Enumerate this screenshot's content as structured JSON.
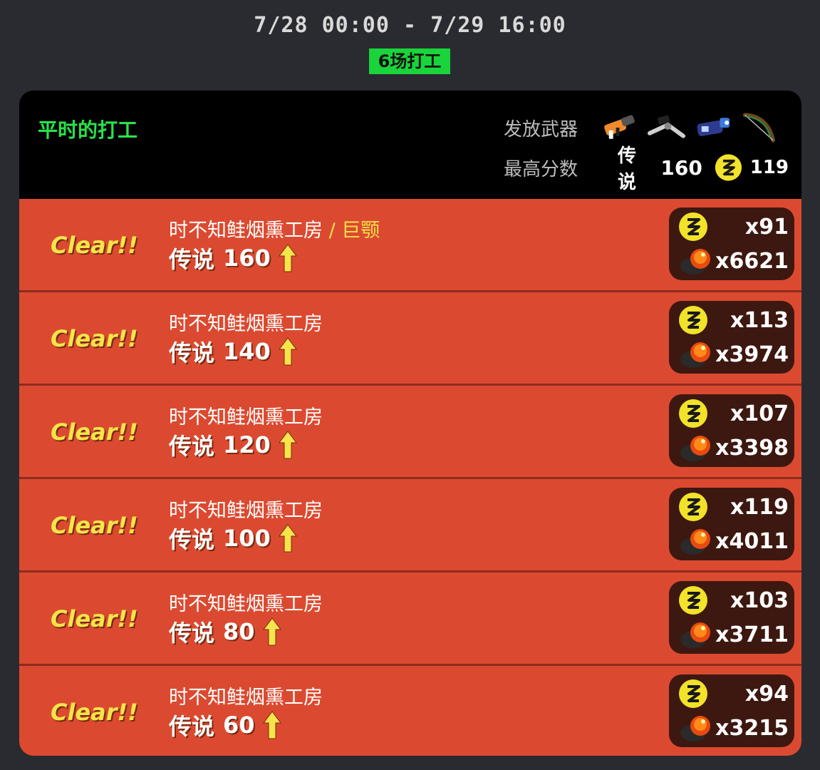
{
  "date_range": "7/28 00:00 - 7/29 16:00",
  "shift_count": "6场打工",
  "mode_title": "平时的打工",
  "weapons_label": "发放武器",
  "best_label": "最高分数",
  "best": {
    "rank": "传说",
    "level": "160",
    "golden_eggs": "119"
  },
  "weapons": [
    "blaster-weapon-icon",
    "stringer-weapon-icon",
    "splatling-weapon-icon",
    "bow-weapon-icon"
  ],
  "colors": {
    "row_bg": "#db4a30",
    "accent_green": "#27e34a",
    "clear_yellow": "#f5e44a",
    "stat_bg": "#3d1810"
  },
  "shifts": [
    {
      "clear": "Clear!!",
      "stage": "时不知鲑烟熏工房",
      "boss": " / 巨颚",
      "rank": "传说",
      "level": "160",
      "golden": "x91",
      "power": "x6621"
    },
    {
      "clear": "Clear!!",
      "stage": "时不知鲑烟熏工房",
      "boss": "",
      "rank": "传说",
      "level": "140",
      "golden": "x113",
      "power": "x3974"
    },
    {
      "clear": "Clear!!",
      "stage": "时不知鲑烟熏工房",
      "boss": "",
      "rank": "传说",
      "level": "120",
      "golden": "x107",
      "power": "x3398"
    },
    {
      "clear": "Clear!!",
      "stage": "时不知鲑烟熏工房",
      "boss": "",
      "rank": "传说",
      "level": "100",
      "golden": "x119",
      "power": "x4011"
    },
    {
      "clear": "Clear!!",
      "stage": "时不知鲑烟熏工房",
      "boss": "",
      "rank": "传说",
      "level": "80",
      "golden": "x103",
      "power": "x3711"
    },
    {
      "clear": "Clear!!",
      "stage": "时不知鲑烟熏工房",
      "boss": "",
      "rank": "传说",
      "level": "60",
      "golden": "x94",
      "power": "x3215"
    }
  ]
}
